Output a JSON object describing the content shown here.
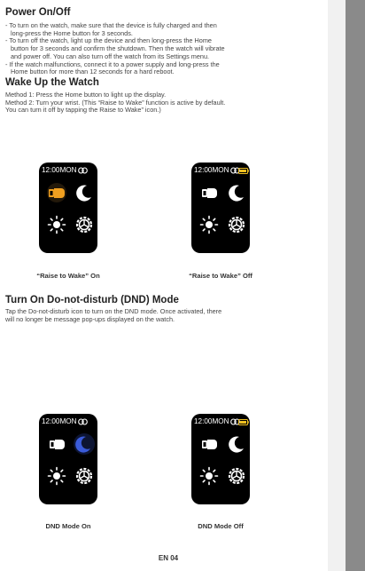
{
  "sections": {
    "power": {
      "title": "Power On/Off",
      "lines": [
        "- To turn on the watch, make sure that the device is fully charged and then",
        "long-press the Home button for 3 seconds.",
        "- To turn off the watch, light up the device and then long-press the Home",
        "button for 3 seconds and confirm the shutdown. Then the watch will vibrate",
        "and power off. You can also turn off the watch from its Settings menu.",
        "- If the watch malfunctions, connect it to a power supply and long-press the",
        "Home button for more than 12 seconds for a hard reboot."
      ]
    },
    "wake": {
      "title": "Wake Up the Watch",
      "lines": [
        "Method 1: Press the Home button to light up the display.",
        "Method 2: Turn your wrist. (This “Raise to Wake” function is active by default.",
        "You can turn it off by tapping the Raise to Wake” icon.)"
      ],
      "captions": [
        "“Raise to Wake” On",
        "“Raise to Wake” Off"
      ]
    },
    "dnd": {
      "title": "Turn On Do-not-disturb (DND) Mode",
      "lines": [
        "Tap the Do-not-disturb icon to turn on the DND mode. Once activated, there",
        "will no longer be message pop-ups displayed on the watch."
      ],
      "captions": [
        "DND Mode On",
        "DND Mode Off"
      ]
    }
  },
  "watch": {
    "time": "12:00MON"
  },
  "colors": {
    "raise_active": "#f0a020",
    "dnd_active": "#3a5bd9",
    "icon_white": "#ffffff"
  },
  "icons": [
    "link-icon",
    "battery-icon",
    "raise-to-wake-icon",
    "moon-icon",
    "brightness-icon",
    "settings-gear-icon"
  ],
  "footer": {
    "page": "EN 04"
  }
}
